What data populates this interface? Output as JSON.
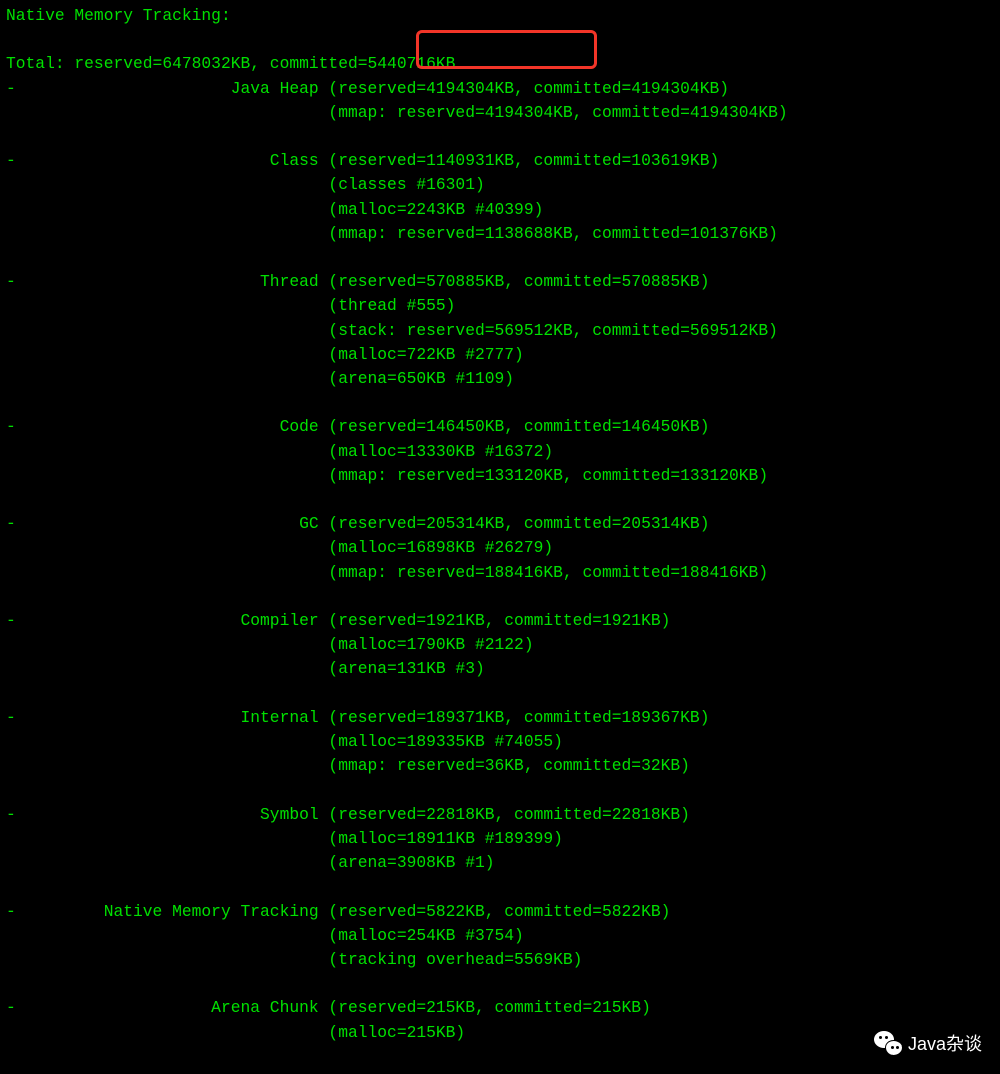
{
  "title": "Native Memory Tracking:",
  "total_line": "Total: reserved=6478032KB, committed=5440716KB",
  "highlighted_value": "5440716KB",
  "watermark": "Java杂谈",
  "sections": [
    {
      "name": "Java Heap",
      "head": "(reserved=4194304KB, committed=4194304KB)",
      "sub": [
        "(mmap: reserved=4194304KB, committed=4194304KB)"
      ]
    },
    {
      "name": "Class",
      "head": "(reserved=1140931KB, committed=103619KB)",
      "sub": [
        "(classes #16301)",
        "(malloc=2243KB #40399)",
        "(mmap: reserved=1138688KB, committed=101376KB)"
      ]
    },
    {
      "name": "Thread",
      "head": "(reserved=570885KB, committed=570885KB)",
      "sub": [
        "(thread #555)",
        "(stack: reserved=569512KB, committed=569512KB)",
        "(malloc=722KB #2777)",
        "(arena=650KB #1109)"
      ]
    },
    {
      "name": "Code",
      "head": "(reserved=146450KB, committed=146450KB)",
      "sub": [
        "(malloc=13330KB #16372)",
        "(mmap: reserved=133120KB, committed=133120KB)"
      ]
    },
    {
      "name": "GC",
      "head": "(reserved=205314KB, committed=205314KB)",
      "sub": [
        "(malloc=16898KB #26279)",
        "(mmap: reserved=188416KB, committed=188416KB)"
      ]
    },
    {
      "name": "Compiler",
      "head": "(reserved=1921KB, committed=1921KB)",
      "sub": [
        "(malloc=1790KB #2122)",
        "(arena=131KB #3)"
      ]
    },
    {
      "name": "Internal",
      "head": "(reserved=189371KB, committed=189367KB)",
      "sub": [
        "(malloc=189335KB #74055)",
        "(mmap: reserved=36KB, committed=32KB)"
      ]
    },
    {
      "name": "Symbol",
      "head": "(reserved=22818KB, committed=22818KB)",
      "sub": [
        "(malloc=18911KB #189399)",
        "(arena=3908KB #1)"
      ]
    },
    {
      "name": "Native Memory Tracking",
      "head": "(reserved=5822KB, committed=5822KB)",
      "sub": [
        "(malloc=254KB #3754)",
        "(tracking overhead=5569KB)"
      ]
    },
    {
      "name": "Arena Chunk",
      "head": "(reserved=215KB, committed=215KB)",
      "sub": [
        "(malloc=215KB)"
      ]
    }
  ]
}
